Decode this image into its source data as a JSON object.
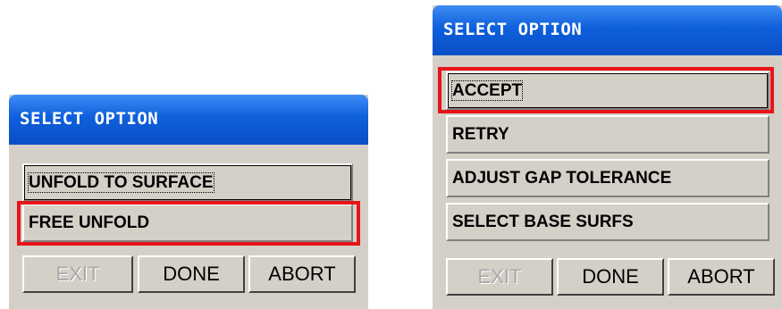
{
  "left_dialog": {
    "title": "SELECT OPTION",
    "options": [
      "UNFOLD TO SURFACE",
      "FREE UNFOLD"
    ],
    "buttons": {
      "exit": "EXIT",
      "done": "DONE",
      "abort": "ABORT"
    }
  },
  "right_dialog": {
    "title": "SELECT OPTION",
    "options": [
      "ACCEPT",
      "RETRY",
      "ADJUST GAP TOLERANCE",
      "SELECT BASE SURFS"
    ],
    "buttons": {
      "exit": "EXIT",
      "done": "DONE",
      "abort": "ABORT"
    }
  },
  "colors": {
    "titlebar": "#0f5fdc",
    "highlight": "#e8141a",
    "panel": "#d4d0c8"
  }
}
